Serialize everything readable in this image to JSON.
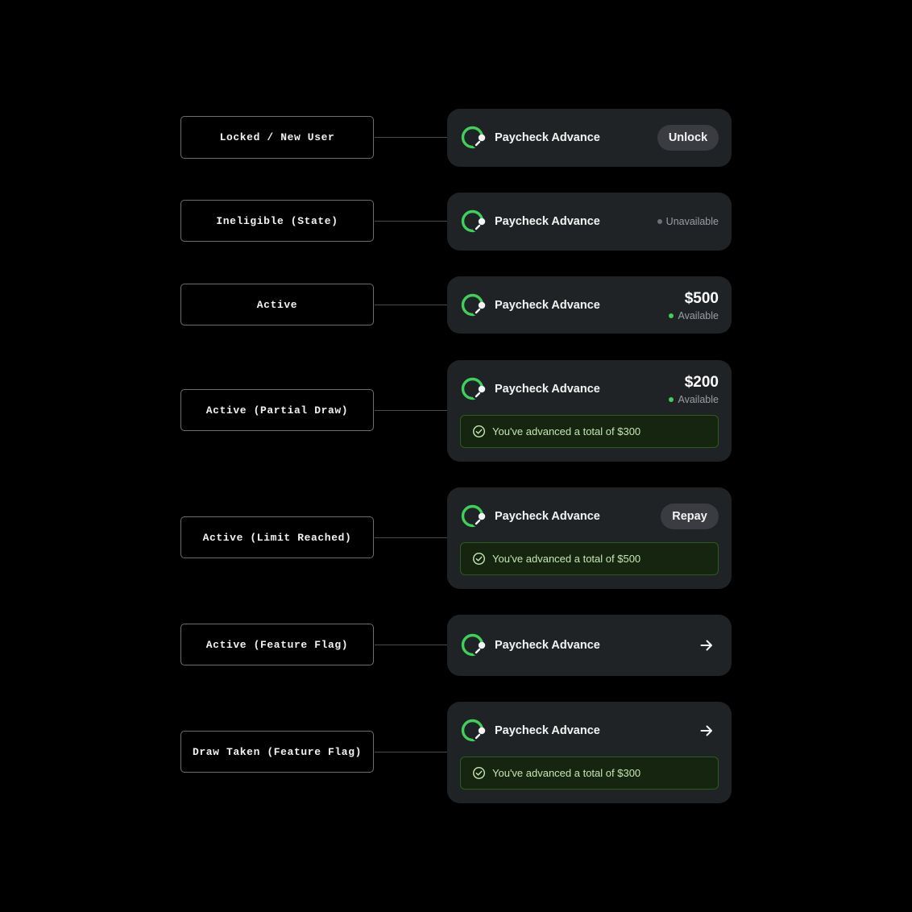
{
  "product_name": "Paycheck Advance",
  "states": [
    {
      "label": "Locked / New User",
      "action": {
        "type": "button",
        "label": "Unlock"
      }
    },
    {
      "label": "Ineligible (State)",
      "status": {
        "text": "Unavailable",
        "color": "#6d7076"
      }
    },
    {
      "label": "Active",
      "amount": "$500",
      "status": {
        "text": "Available",
        "color": "#3ecf5c"
      }
    },
    {
      "label": "Active (Partial Draw)",
      "amount": "$200",
      "status": {
        "text": "Available",
        "color": "#3ecf5c"
      },
      "banner": "You've advanced a total of $300"
    },
    {
      "label": "Active (Limit Reached)",
      "action": {
        "type": "button",
        "label": "Repay"
      },
      "banner": "You've advanced a total of $500"
    },
    {
      "label": "Active (Feature Flag)",
      "action": {
        "type": "icon",
        "icon": "arrow-right-icon"
      }
    },
    {
      "label": "Draw Taken (Feature Flag)",
      "action": {
        "type": "icon",
        "icon": "arrow-right-icon"
      },
      "banner": "You've advanced a total of $300"
    }
  ],
  "colors": {
    "background": "#000000",
    "card": "#202325",
    "accent_green": "#3ecf5c",
    "banner_bg": "#152510",
    "banner_border": "#2d5a1e"
  }
}
